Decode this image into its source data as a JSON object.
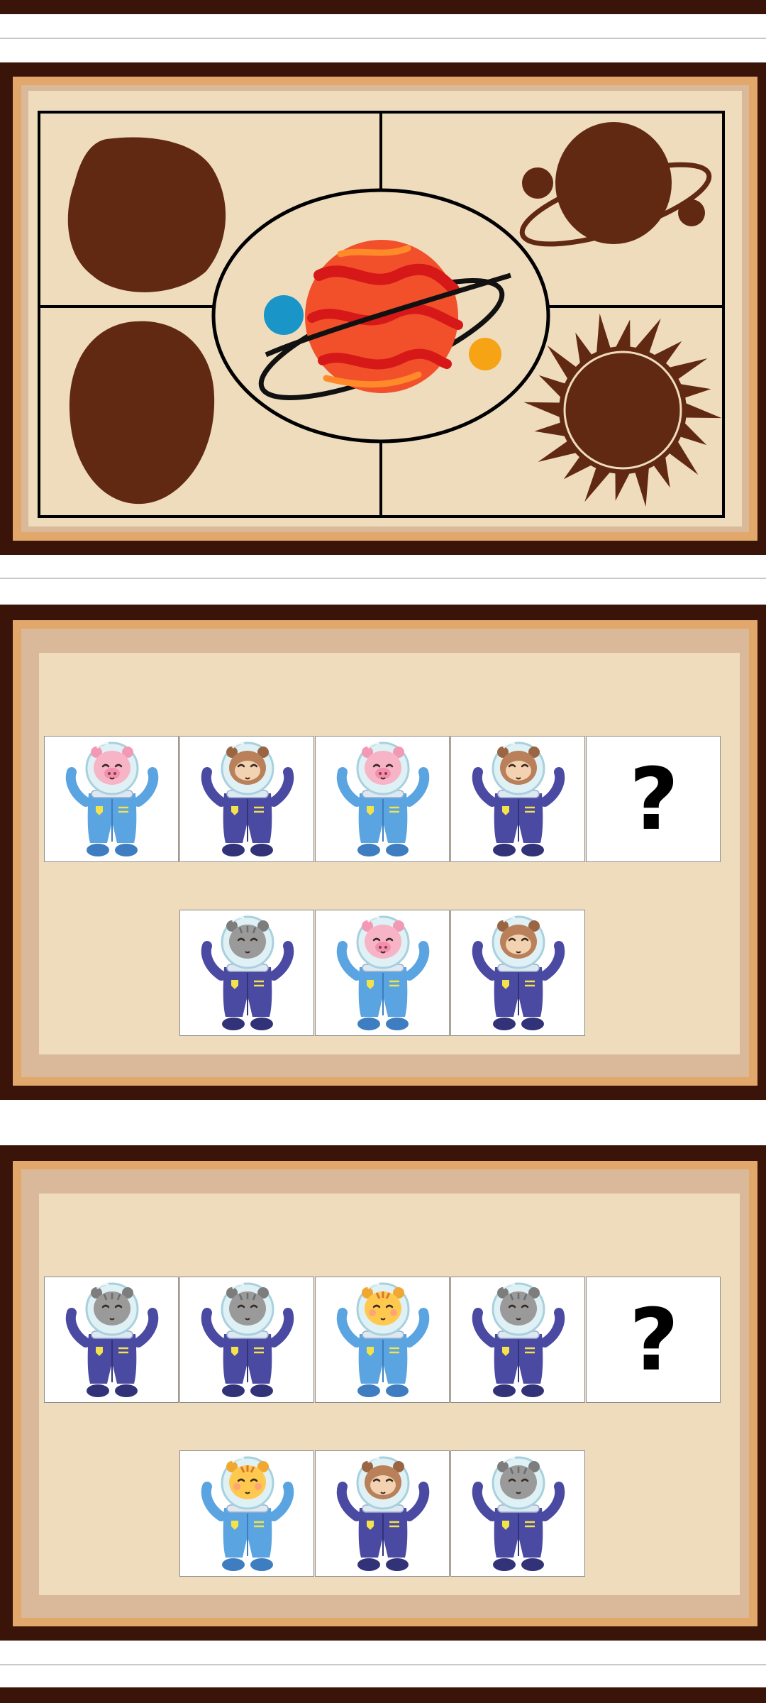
{
  "theme": {
    "dark": "#3a1408",
    "frame": "#e2a86b",
    "frame_inner": "#d9b99a",
    "board": "#efdcbd",
    "silhouette": "#612911"
  },
  "space_puzzle": {
    "center_piece": "planet-with-two-moons",
    "slots": [
      "irregular-rock-shape",
      "ringed-planet-shape",
      "oval-rock-shape",
      "sun-shape"
    ]
  },
  "puzzles": [
    {
      "sequence": [
        {
          "animal": "pig",
          "suit": "light-blue"
        },
        {
          "animal": "monkey",
          "suit": "navy"
        },
        {
          "animal": "pig",
          "suit": "light-blue"
        },
        {
          "animal": "monkey",
          "suit": "navy"
        }
      ],
      "missing_label": "?",
      "options": [
        {
          "animal": "cat",
          "suit": "navy"
        },
        {
          "animal": "pig",
          "suit": "light-blue"
        },
        {
          "animal": "monkey",
          "suit": "navy"
        }
      ]
    },
    {
      "sequence": [
        {
          "animal": "cat",
          "suit": "navy"
        },
        {
          "animal": "cat",
          "suit": "navy"
        },
        {
          "animal": "tiger",
          "suit": "light-blue"
        },
        {
          "animal": "cat",
          "suit": "navy"
        }
      ],
      "missing_label": "?",
      "options": [
        {
          "animal": "tiger",
          "suit": "light-blue"
        },
        {
          "animal": "monkey",
          "suit": "navy"
        },
        {
          "animal": "cat",
          "suit": "navy"
        }
      ]
    }
  ]
}
